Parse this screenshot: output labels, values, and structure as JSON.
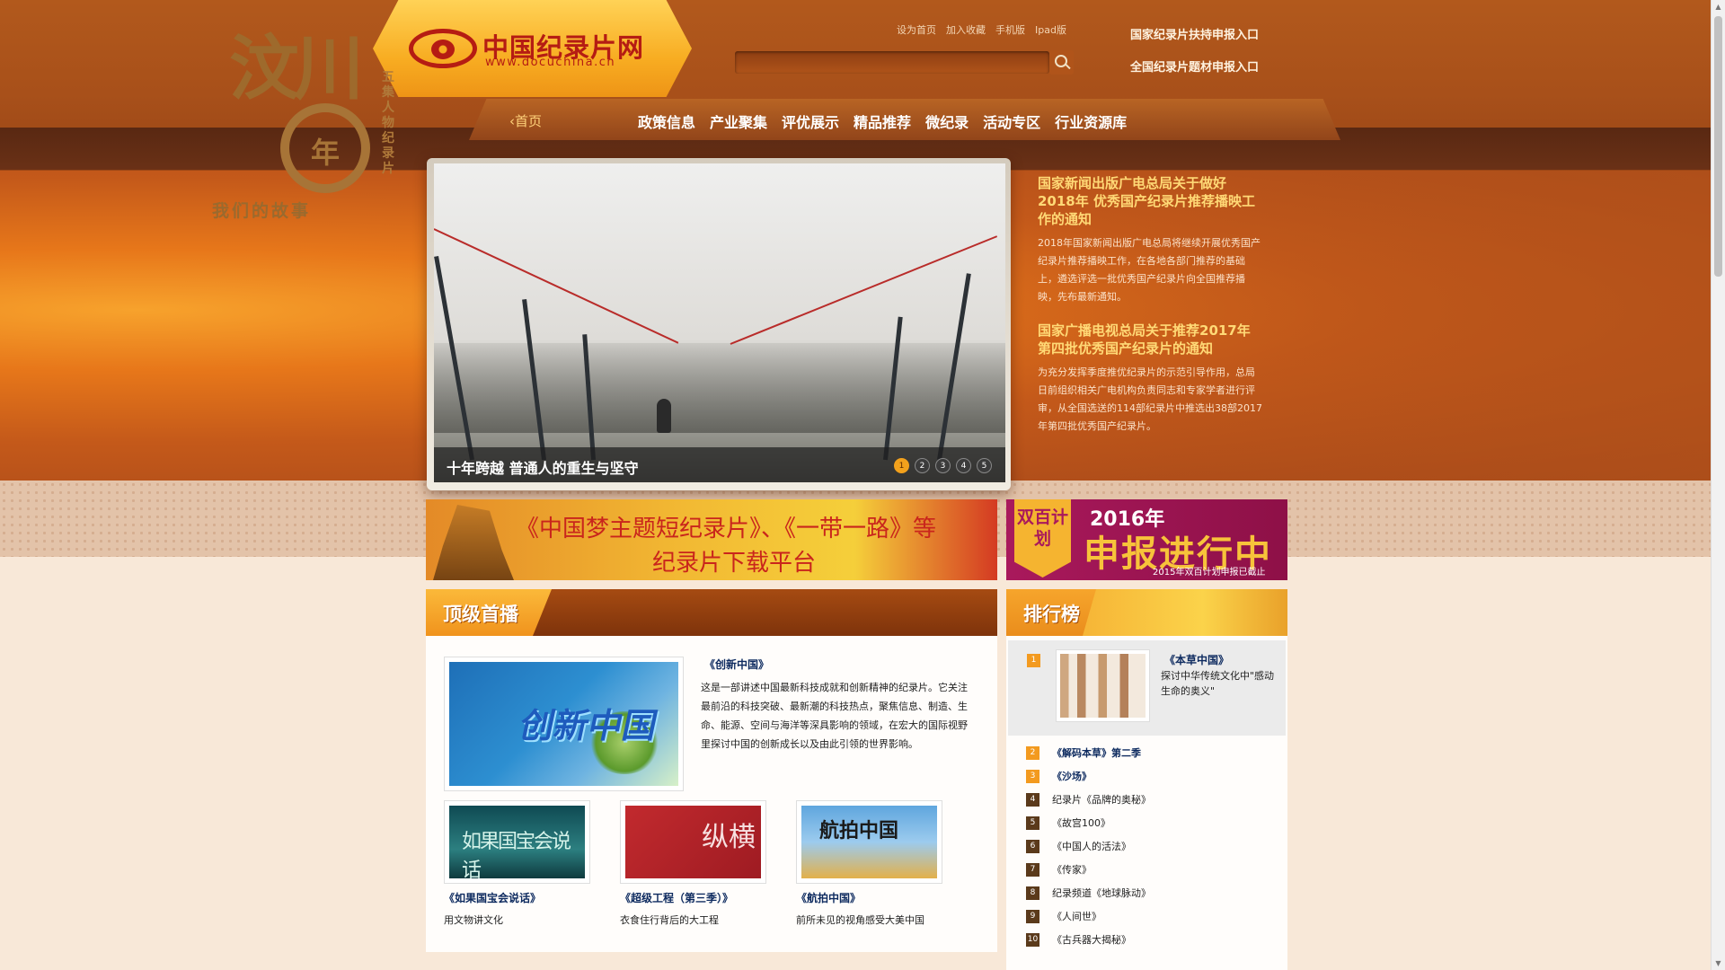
{
  "header": {
    "logo_cn": "中国纪录片网",
    "logo_en": "www.docuchina.cn",
    "top_links": [
      "设为首页",
      "加入收藏",
      "手机版",
      "Ipad版"
    ],
    "search_placeholder": "",
    "entry_1": "国家纪录片扶持申报入口",
    "entry_2": "全国纪录片题材申报入口"
  },
  "nav": {
    "home": "首页",
    "items": [
      "政策信息",
      "产业聚集",
      "评优展示",
      "精品推荐",
      "微纪录",
      "活动专区",
      "行业资源库"
    ]
  },
  "slider": {
    "big_title": "汶川",
    "ring_text": "年",
    "subtitle": "我们的故事",
    "vertical_text": "五集人物纪录片",
    "caption": "十年跨越 普通人的重生与坚守",
    "pages": [
      "1",
      "2",
      "3",
      "4",
      "5"
    ],
    "active_page": 1
  },
  "news": [
    {
      "title": "国家新闻出版广电总局关于做好2018年 优秀国产纪录片推荐播映工作的通知",
      "summary": "2018年国家新闻出版广电总局将继续开展优秀国产纪录片推荐播映工作，在各地各部门推荐的基础上，遴选评选一批优秀国产纪录片向全国推荐播映，先布最新通知。"
    },
    {
      "title": "国家广播电视总局关于推荐2017年第四批优秀国产纪录片的通知",
      "summary": "为充分发挥季度推优纪录片的示范引导作用，总局日前组织相关广电机构负责同志和专家学者进行评审，从全国选送的114部纪录片中推选出38部2017年第四批优秀国产纪录片。"
    }
  ],
  "banners": {
    "left_line1": "《中国梦主题短纪录片》、《一带一路》等",
    "left_line2": "纪录片下载平台",
    "right_tag": "双百计划",
    "right_year": "2016年",
    "right_big": "申报进行中",
    "right_small": "2015年双百计划申报已截止"
  },
  "top_broadcast": {
    "heading": "顶级首播",
    "featured": {
      "thumb_text": "创新中国",
      "title": "《创新中国》",
      "description": "这是一部讲述中国最新科技成就和创新精神的纪录片。它关注最前沿的科技突破、最新潮的科技热点，聚焦信息、制造、生命、能源、空间与海洋等深具影响的领域，在宏大的国际视野里探讨中国的创新成长以及由此引领的世界影响。"
    },
    "items": [
      {
        "title": "《如果国宝会说话》",
        "desc": "用文物讲文化",
        "thumb_text": "如果国宝会说话"
      },
      {
        "title": "《超级工程（第三季）》",
        "desc": "衣食住行背后的大工程",
        "thumb_text": "纵横"
      },
      {
        "title": "《航拍中国》",
        "desc": "前所未见的视角感受大美中国",
        "thumb_text": "航拍中国"
      }
    ]
  },
  "ranking": {
    "heading": "排行榜",
    "top": {
      "num": "1",
      "title": "《本草中国》",
      "desc": "探讨中华传统文化中\"感动生命的奥义\""
    },
    "items": [
      {
        "num": "2",
        "label": "《解码本草》第二季",
        "highlight": true
      },
      {
        "num": "3",
        "label": "《沙场》",
        "highlight": true
      },
      {
        "num": "4",
        "label": "纪录片《品牌的奥秘》",
        "highlight": false
      },
      {
        "num": "5",
        "label": "《故宫100》",
        "highlight": false
      },
      {
        "num": "6",
        "label": "《中国人的活法》",
        "highlight": false
      },
      {
        "num": "7",
        "label": "《传家》",
        "highlight": false
      },
      {
        "num": "8",
        "label": "纪录频道《地球脉动》",
        "highlight": false
      },
      {
        "num": "9",
        "label": "《人间世》",
        "highlight": false
      },
      {
        "num": "10",
        "label": "《古兵器大揭秘》",
        "highlight": false
      }
    ]
  },
  "colors": {
    "accent": "#f39a1f",
    "brand_red": "#b51c13",
    "header_bg": "#a8501a",
    "title_blue": "#0d2a5f"
  }
}
